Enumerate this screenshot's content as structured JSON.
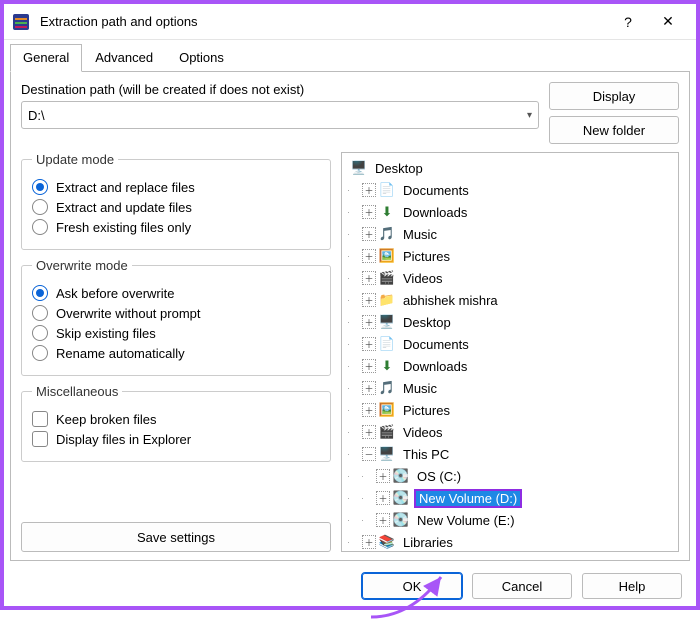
{
  "window": {
    "title": "Extraction path and options",
    "help": "?",
    "close": "✕"
  },
  "tabs": {
    "general": "General",
    "advanced": "Advanced",
    "options": "Options"
  },
  "dest": {
    "label": "Destination path (will be created if does not exist)",
    "value": "D:\\"
  },
  "buttons": {
    "display": "Display",
    "new_folder": "New folder",
    "save": "Save settings",
    "ok": "OK",
    "cancel": "Cancel",
    "help": "Help"
  },
  "update_mode": {
    "legend": "Update mode",
    "replace": "Extract and replace files",
    "update": "Extract and update files",
    "fresh": "Fresh existing files only"
  },
  "overwrite_mode": {
    "legend": "Overwrite mode",
    "ask": "Ask before overwrite",
    "without": "Overwrite without prompt",
    "skip": "Skip existing files",
    "rename": "Rename automatically"
  },
  "misc": {
    "legend": "Miscellaneous",
    "keep": "Keep broken files",
    "explorer": "Display files in Explorer"
  },
  "tree": {
    "desktop": "Desktop",
    "documents": "Documents",
    "downloads": "Downloads",
    "music": "Music",
    "pictures": "Pictures",
    "videos": "Videos",
    "abhishek": "abhishek mishra",
    "this_pc": "This PC",
    "os_c": "OS (C:)",
    "new_d": "New Volume (D:)",
    "new_e": "New Volume (E:)",
    "libraries": "Libraries"
  }
}
